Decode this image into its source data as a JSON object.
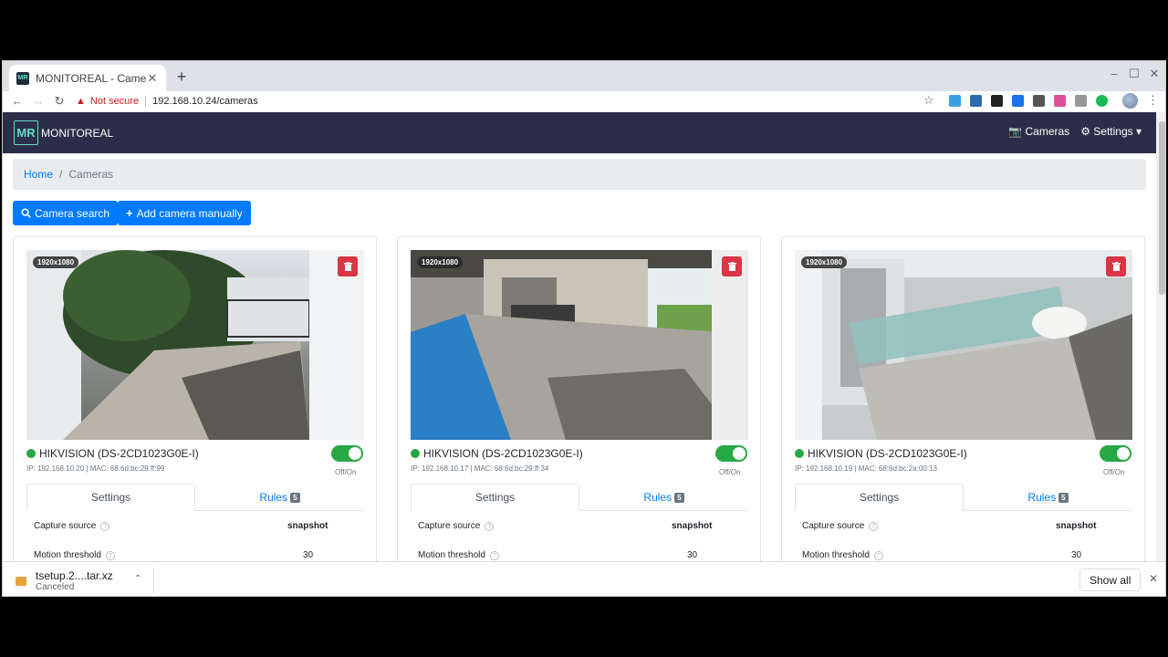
{
  "browser": {
    "tab_title": "MONITOREAL - Camer",
    "not_secure": "Not secure",
    "url": "192.168.10.24/cameras",
    "new_tab": "+",
    "tab_close": "✕"
  },
  "navbar": {
    "brand_logo": "MR",
    "brand_name": "MONITOREAL",
    "cameras_label": "Cameras",
    "settings_label": "Settings"
  },
  "breadcrumb": {
    "home": "Home",
    "current": "Cameras"
  },
  "actions": {
    "camera_search": "Camera search",
    "add_camera": "Add camera manually"
  },
  "cameras": [
    {
      "resolution": "1920x1080",
      "name": "HIKVISION (DS-2CD1023G0E-I)",
      "meta": "IP: 192.168.10.20 | MAC: 68:6d:bc:29:ff:99",
      "toggle_label": "Off/On",
      "tab_settings": "Settings",
      "tab_rules": "Rules",
      "rules_count": "5",
      "capture_source_label": "Capture source",
      "capture_source_value": "snapshot",
      "motion_threshold_label": "Motion threshold",
      "motion_threshold_value": "30"
    },
    {
      "resolution": "1920x1080",
      "name": "HIKVISION (DS-2CD1023G0E-I)",
      "meta": "IP: 192.168.10.17 | MAC: 68:6d:bc:29:ff:34",
      "toggle_label": "Off/On",
      "tab_settings": "Settings",
      "tab_rules": "Rules",
      "rules_count": "5",
      "capture_source_label": "Capture source",
      "capture_source_value": "snapshot",
      "motion_threshold_label": "Motion threshold",
      "motion_threshold_value": "30"
    },
    {
      "resolution": "1920x1080",
      "name": "HIKVISION (DS-2CD1023G0E-I)",
      "meta": "IP: 192.168.10.19 | MAC: 68:6d:bc:2a:00:13",
      "toggle_label": "Off/On",
      "tab_settings": "Settings",
      "tab_rules": "Rules",
      "rules_count": "5",
      "capture_source_label": "Capture source",
      "capture_source_value": "snapshot",
      "motion_threshold_label": "Motion threshold",
      "motion_threshold_value": "30"
    }
  ],
  "download": {
    "filename": "tsetup.2....tar.xz",
    "status": "Canceled",
    "show_all": "Show all"
  },
  "colors": {
    "navbar": "#2b2e48",
    "primary": "#007bff",
    "danger": "#dc3545",
    "success": "#28a745"
  }
}
